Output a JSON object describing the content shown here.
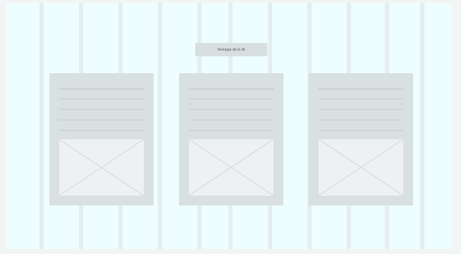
{
  "banner": {
    "title": "Ventajas de la IA"
  },
  "cards": [
    {
      "image": "image-placeholder-icon",
      "text_lines": 5
    },
    {
      "image": "image-placeholder-icon",
      "text_lines": 5
    },
    {
      "image": "image-placeholder-icon",
      "text_lines": 5
    }
  ],
  "colors": {
    "page_background": "#f3f4f4",
    "frame_background": "#eefdfe",
    "grid_column": "#dcdde0",
    "card_background": "#d9e0e1",
    "text_line": "#c4cbcd",
    "image_placeholder": "#eef1f1"
  }
}
